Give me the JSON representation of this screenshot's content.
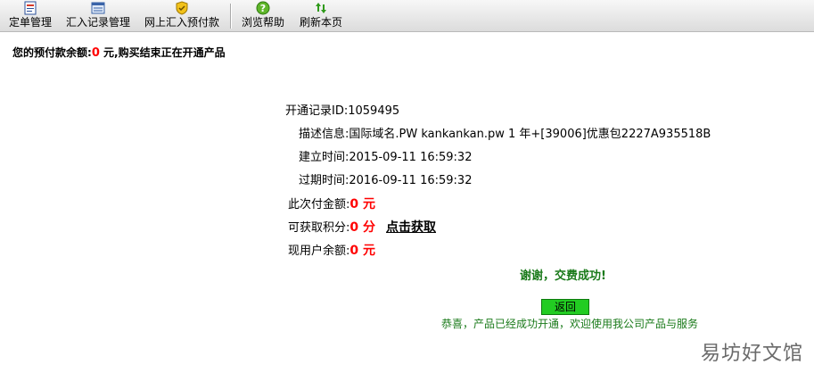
{
  "toolbar": {
    "items": [
      {
        "label": "定单管理",
        "icon": "order-form-icon"
      },
      {
        "label": "汇入记录管理",
        "icon": "records-list-icon"
      },
      {
        "label": "网上汇入预付款",
        "icon": "shield-payment-icon"
      },
      {
        "label": "浏览帮助",
        "icon": "help-icon"
      },
      {
        "label": "刷新本页",
        "icon": "refresh-icon"
      }
    ]
  },
  "balance": {
    "prefix": "您的预付款余额:",
    "amount": "0",
    "suffix": " 元,购买结束正在开通产品"
  },
  "record": {
    "id_label": "开通记录ID:",
    "id_value": "1059495",
    "desc_label": "描述信息:",
    "desc_value": "国际域名.PW kankankan.pw 1 年+[39006]优惠包2227A935518B",
    "created_label": "建立时间:",
    "created_value": "2015-09-11 16:59:32",
    "expire_label": "过期时间:",
    "expire_value": "2016-09-11 16:59:32",
    "paid_label": "此次付金额:",
    "paid_value": "0 元",
    "points_label": "可获取积分:",
    "points_value": "0 分",
    "points_link": "点击获取",
    "user_balance_label": "现用户余额:",
    "user_balance_value": "0 元"
  },
  "result": {
    "thanks": "谢谢，交费成功!",
    "return_label": "返回",
    "congrats": "恭喜，产品已经成功开通，欢迎使用我公司产品与服务"
  },
  "watermark": "易坊好文馆",
  "colors": {
    "amount_red": "#ff0000",
    "success_green": "#1a7a1a",
    "button_green": "#22cc22"
  }
}
